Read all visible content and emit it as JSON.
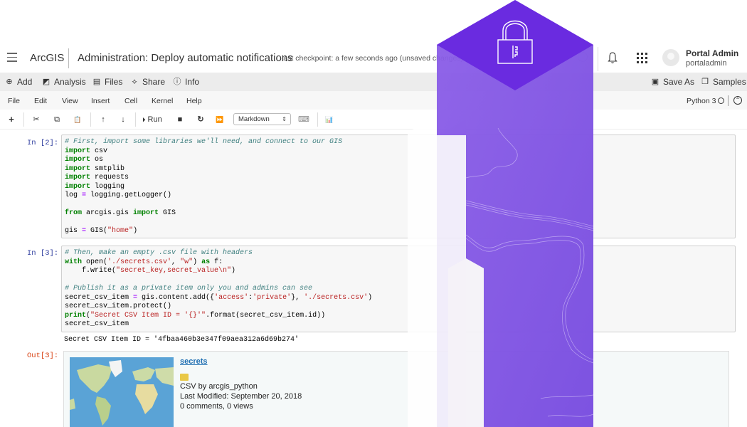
{
  "header": {
    "brand": "ArcGIS",
    "notebook_title": "Administration: Deploy automatic notifications",
    "checkpoint": "last checkpoint: a few seconds ago (unsaved changes)",
    "user_name": "Portal Admin",
    "user_handle": "portaladmin"
  },
  "actionbar": {
    "left": [
      {
        "icon": "add-icon",
        "glyph": "⊕",
        "label": "Add"
      },
      {
        "icon": "analysis-icon",
        "glyph": "◩",
        "label": "Analysis"
      },
      {
        "icon": "files-icon",
        "glyph": "▤",
        "label": "Files"
      },
      {
        "icon": "share-icon",
        "glyph": "⟡",
        "label": "Share"
      },
      {
        "icon": "info-icon",
        "glyph": "ⓘ",
        "label": "Info"
      }
    ],
    "right": [
      {
        "icon": "save-icon",
        "glyph": "▣",
        "label": "Save As"
      },
      {
        "icon": "samples-icon",
        "glyph": "❐",
        "label": "Samples"
      }
    ]
  },
  "menubar": {
    "items": [
      "File",
      "Edit",
      "View",
      "Insert",
      "Cell",
      "Kernel",
      "Help"
    ],
    "kernel_name": "Python 3",
    "collapse_glyph": "⌃"
  },
  "toolbar": {
    "insert_glyph": "+",
    "cut_glyph": "✂",
    "copy_glyph": "⧉",
    "paste_glyph": "📋",
    "up_glyph": "↑",
    "down_glyph": "↓",
    "run_label": "Run",
    "run_glyph": "⏵",
    "stop_glyph": "■",
    "restart_glyph": "↻",
    "fastforward_glyph": "⏩",
    "cell_type": "Markdown",
    "cell_type_arrows": "⇕",
    "keyboard_glyph": "⌨",
    "chart_glyph": "📊"
  },
  "cells": [
    {
      "prompt": "In [2]:",
      "lines": [
        [
          [
            "cm",
            "# First, import some libraries we'll need, and connect to our GIS"
          ]
        ],
        [
          [
            "kw",
            "import"
          ],
          [
            "",
            " csv"
          ]
        ],
        [
          [
            "kw",
            "import"
          ],
          [
            "",
            " os"
          ]
        ],
        [
          [
            "kw",
            "import"
          ],
          [
            "",
            " smtplib"
          ]
        ],
        [
          [
            "kw",
            "import"
          ],
          [
            "",
            " requests"
          ]
        ],
        [
          [
            "kw",
            "import"
          ],
          [
            "",
            " logging"
          ]
        ],
        [
          [
            "",
            "log "
          ],
          [
            "op",
            "="
          ],
          [
            "",
            " logging.getLogger()"
          ]
        ],
        [
          [
            "",
            ""
          ]
        ],
        [
          [
            "kw",
            "from"
          ],
          [
            "",
            " arcgis.gis "
          ],
          [
            "kw",
            "import"
          ],
          [
            "",
            " GIS"
          ]
        ],
        [
          [
            "",
            ""
          ]
        ],
        [
          [
            "",
            "gis "
          ],
          [
            "op",
            "="
          ],
          [
            "",
            " GIS("
          ],
          [
            "st",
            "\"home\""
          ],
          [
            "",
            ")"
          ]
        ]
      ]
    },
    {
      "prompt": "In [3]:",
      "lines": [
        [
          [
            "cm",
            "# Then, make an empty .csv file with headers"
          ]
        ],
        [
          [
            "kw",
            "with"
          ],
          [
            "",
            " open("
          ],
          [
            "st",
            "'./secrets.csv'"
          ],
          [
            "",
            ", "
          ],
          [
            "st",
            "\"w\""
          ],
          [
            "",
            ") "
          ],
          [
            "kw",
            "as"
          ],
          [
            "",
            " f:"
          ]
        ],
        [
          [
            "",
            "    f.write("
          ],
          [
            "st",
            "\"secret_key,secret_value\\n\""
          ],
          [
            "",
            ")"
          ]
        ],
        [
          [
            "",
            ""
          ]
        ],
        [
          [
            "cm",
            "# Publish it as a private item only you and admins can see"
          ]
        ],
        [
          [
            "",
            "secret_csv_item "
          ],
          [
            "op",
            "="
          ],
          [
            "",
            " gis.content.add({"
          ],
          [
            "st",
            "'access'"
          ],
          [
            "",
            ":"
          ],
          [
            "st",
            "'private'"
          ],
          [
            "",
            "}, "
          ],
          [
            "st",
            "'./secrets.csv'"
          ],
          [
            "",
            ")"
          ]
        ],
        [
          [
            "",
            "secret_csv_item.protect()"
          ]
        ],
        [
          [
            "kw",
            "print"
          ],
          [
            "",
            "("
          ],
          [
            "st",
            "\"Secret CSV Item ID = '{}'\""
          ],
          [
            "",
            ".format(secret_csv_item.id))"
          ]
        ],
        [
          [
            "",
            "secret_csv_item"
          ]
        ]
      ],
      "stdout": "Secret CSV Item ID = '4fbaa460b3e347f09aea312a6d69b274'"
    }
  ],
  "output": {
    "prompt": "Out[3]:",
    "item_title": "secrets",
    "item_type_line": "CSV by arcgis_python",
    "modified_line": "Last Modified: September 20, 2018",
    "stats_line": "0 comments, 0 views"
  },
  "colors": {
    "accent_purple": "#6a2be0",
    "purple_light": "#8a5ae6",
    "prompt_in": "#303F9F",
    "prompt_out": "#D84315",
    "link": "#1f6fb2"
  }
}
